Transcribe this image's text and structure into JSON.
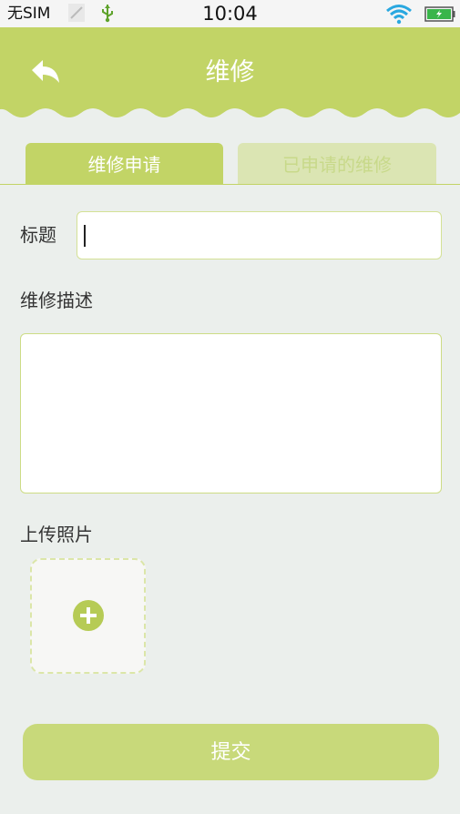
{
  "status_bar": {
    "carrier": "无SIM",
    "time": "10:04",
    "icons": [
      "sim-icon",
      "usb-icon",
      "wifi-icon",
      "battery-icon"
    ]
  },
  "header": {
    "title": "维修",
    "back_icon": "back-arrow-icon"
  },
  "tabs": [
    {
      "label": "维修申请",
      "active": true
    },
    {
      "label": "已申请的维修",
      "active": false
    }
  ],
  "form": {
    "title_label": "标题",
    "title_value": "",
    "description_label": "维修描述",
    "description_value": "",
    "photo_label": "上传照片",
    "add_photo_icon": "plus-circle-icon"
  },
  "submit_label": "提交",
  "colors": {
    "accent": "#c2d466",
    "background": "#ebefec",
    "tab_inactive": "#dbe5b3",
    "submit": "#c8d97a"
  }
}
